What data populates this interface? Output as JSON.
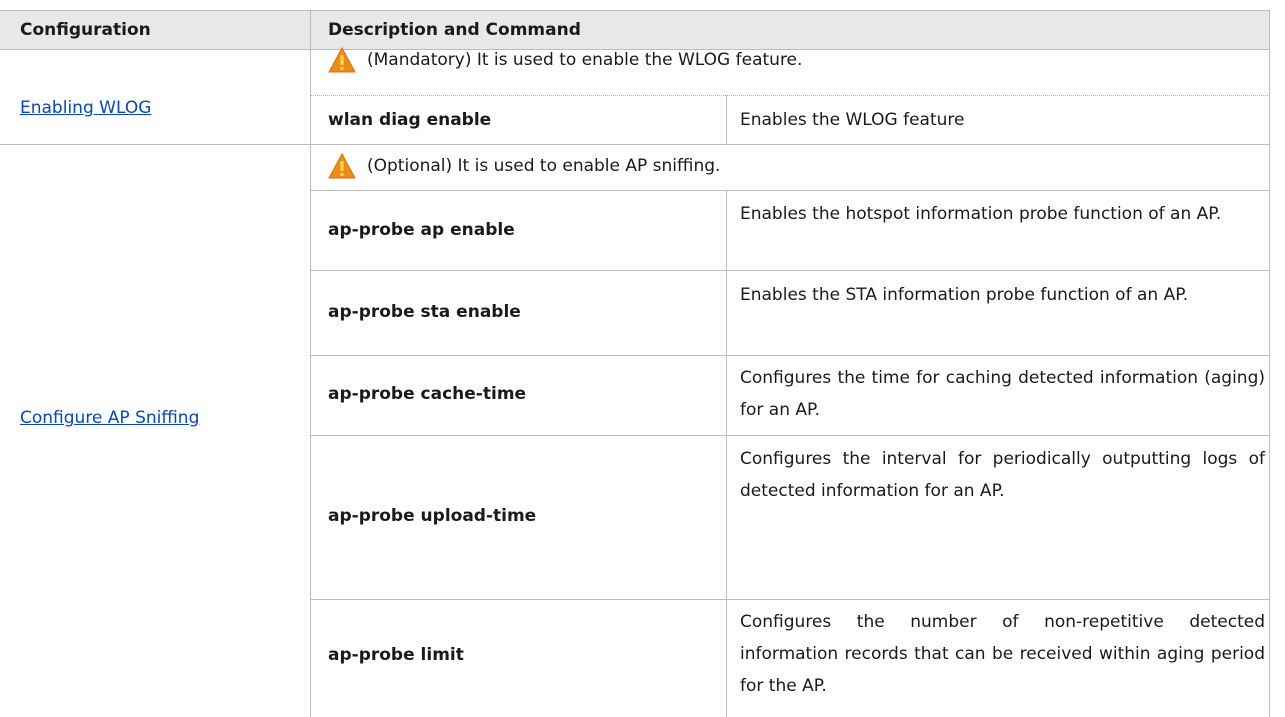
{
  "header": {
    "col1": "Configuration",
    "col2": "Description and Command"
  },
  "sections": [
    {
      "link": "Enabling WLOG",
      "note": "(Mandatory) It is used to enable the WLOG feature.",
      "commands": [
        {
          "cmd": "wlan diag enable",
          "desc": "Enables the WLOG feature"
        }
      ]
    },
    {
      "link": "Configure AP Sniffing",
      "note": "(Optional) It is used to enable AP sniffing.",
      "commands": [
        {
          "cmd": "ap-probe ap enable",
          "desc": "Enables the hotspot information probe function of an AP."
        },
        {
          "cmd": "ap-probe sta enable",
          "desc": "Enables the STA information probe function of an AP."
        },
        {
          "cmd": "ap-probe cache-time",
          "desc": "Configures the time for caching detected information (aging) for an AP."
        },
        {
          "cmd": "ap-probe upload-time",
          "desc": "Configures the interval for periodically outputting logs of detected information for an AP."
        },
        {
          "cmd": "ap-probe limit",
          "desc": "Configures the number of non-repetitive detected information records that can be received within aging period for the AP."
        }
      ]
    }
  ],
  "colors": {
    "link": "#0645c8",
    "header_bg": "#e8e8e8",
    "warning_fill": "#f08a1c",
    "grid": "#bdbdbd"
  }
}
